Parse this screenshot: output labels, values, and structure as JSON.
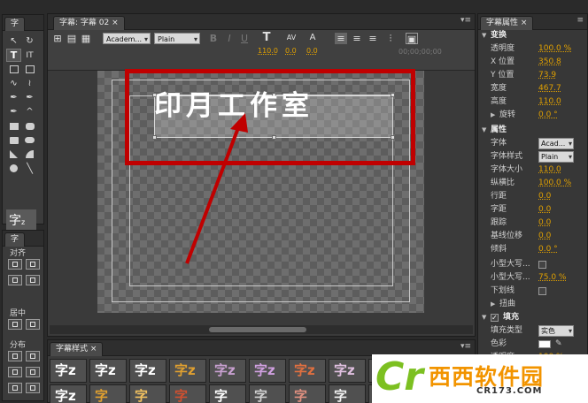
{
  "tools_panel": {
    "tab": "字",
    "preview_glyph": "字",
    "preview_suffix": "z"
  },
  "actions_panel": {
    "tab": "字",
    "align_label": "对齐",
    "center_label": "居中",
    "distribute_label": "分布"
  },
  "title_panel": {
    "tab": "字幕: 字幕 02",
    "font_family": "Academ...",
    "font_style": "Plain",
    "bold_label": "B",
    "italic_label": "I",
    "underline_label": "U",
    "font_size": "110.0",
    "kerning": "0.0",
    "leading": "0.0",
    "timecode": "00;00;00;00",
    "title_text": "印月工作室"
  },
  "styles_panel": {
    "tab": "字幕样式",
    "swatches": [
      "字z",
      "字z",
      "字z",
      "字z",
      "字z",
      "字z",
      "字z",
      "字z",
      "字z",
      "字z",
      "字",
      "字",
      "字",
      "字",
      "字",
      "字",
      "字",
      "字z"
    ]
  },
  "properties_panel": {
    "tab": "字幕属性",
    "transform": {
      "section": "变换",
      "rows": [
        {
          "label": "透明度",
          "value": "100.0 %"
        },
        {
          "label": "X 位置",
          "value": "350.8"
        },
        {
          "label": "Y 位置",
          "value": "73.9"
        },
        {
          "label": "宽度",
          "value": "467.7"
        },
        {
          "label": "高度",
          "value": "110.0"
        },
        {
          "label": "旋转",
          "value": "0.0 °"
        }
      ]
    },
    "properties": {
      "section": "属性",
      "font_label": "字体",
      "font_value": "Acad...",
      "style_label": "字体样式",
      "style_value": "Plain",
      "rows": [
        {
          "label": "字体大小",
          "value": "110.0"
        },
        {
          "label": "纵横比",
          "value": "100.0 %"
        },
        {
          "label": "行距",
          "value": "0.0"
        },
        {
          "label": "字距",
          "value": "0.0"
        },
        {
          "label": "跟踪",
          "value": "0.0"
        },
        {
          "label": "基线位移",
          "value": "0.0"
        },
        {
          "label": "倾斜",
          "value": "0.0 °"
        }
      ],
      "smallcaps_label": "小型大写...",
      "smallcaps_size_label": "小型大写...",
      "smallcaps_size_value": "75.0 %",
      "underline_label": "下划线",
      "distort_label": "扭曲"
    },
    "fill": {
      "section": "填充",
      "type_label": "填充类型",
      "type_value": "实色",
      "color_label": "色彩",
      "opacity_label": "透明度",
      "opacity_value": "100 %"
    }
  },
  "watermark": {
    "letter": "Cr",
    "cn_text": "西西软件园",
    "en_text": "CR173.COM"
  }
}
